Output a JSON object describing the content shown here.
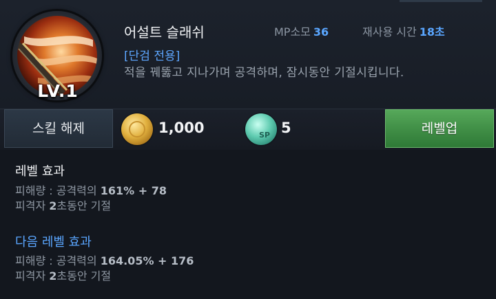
{
  "skill": {
    "name": "어설트 슬래쉬",
    "level": "LV.1",
    "mp_label": "MP소모",
    "mp_value": "36",
    "cooldown_label": "재사용 시간",
    "cooldown_value": "18초",
    "tag": "[단검 전용]",
    "description": "적을 꿰뚫고 지나가며 공격하며, 잠시동안 기절시킵니다."
  },
  "actions": {
    "release_label": "스킬 해제",
    "gold_icon": "gold-coin-icon",
    "gold_cost": "1,000",
    "sp_icon": "sp-orb-icon",
    "sp_cost": "5",
    "levelup_label": "레벨업"
  },
  "current_effect": {
    "title": "레벨 효과",
    "damage_prefix": "피해량 : 공격력의 ",
    "damage_percent": "161%",
    "damage_plus": " + ",
    "damage_flat": "78",
    "stun_prefix": "피격자 ",
    "stun_seconds": "2",
    "stun_suffix": "초동안 기절"
  },
  "next_effect": {
    "title": "다음 레벨 효과",
    "damage_prefix": "피해량 : 공격력의 ",
    "damage_percent": "164.05%",
    "damage_plus": " + ",
    "damage_flat": "176",
    "stun_prefix": "피격자 ",
    "stun_seconds": "2",
    "stun_suffix": "초동안 기절"
  },
  "colors": {
    "accent_blue": "#5aa6ff",
    "levelup_green": "#3f8d45",
    "background": "#141820"
  }
}
